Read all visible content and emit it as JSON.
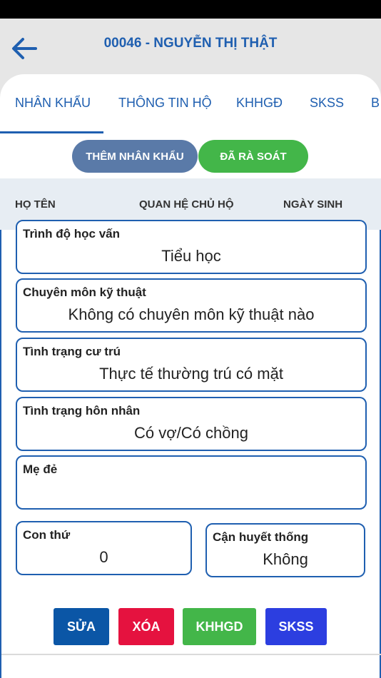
{
  "header": {
    "title": "00046 - NGUYỄN THỊ THẬT"
  },
  "tabs": [
    {
      "label": "NHÂN KHẨU"
    },
    {
      "label": "THÔNG TIN HỘ"
    },
    {
      "label": "KHHGĐ"
    },
    {
      "label": "SKSS"
    },
    {
      "label": "B"
    }
  ],
  "buttons": {
    "add_member": "THÊM NHÂN KHẨU",
    "reviewed": "ĐÃ RÀ SOÁT"
  },
  "columns": [
    "HỌ TÊN",
    "QUAN HỆ CHỦ HỘ",
    "NGÀY SINH"
  ],
  "fields": {
    "education": {
      "label": "Trình độ học vấn",
      "value": "Tiểu học"
    },
    "specialty": {
      "label": "Chuyên môn kỹ thuật",
      "value": "Không có chuyên môn kỹ thuật nào"
    },
    "residence": {
      "label": "Tình trạng cư trú",
      "value": "Thực tế thường trú có mặt"
    },
    "marital": {
      "label": "Tình trạng hôn nhân",
      "value": "Có vợ/Có chồng"
    },
    "mother": {
      "label": "Mẹ đẻ",
      "value": ""
    },
    "child_order": {
      "label": "Con thứ",
      "value": "0"
    },
    "consanguinity": {
      "label": "Cận huyết thống",
      "value": "Không"
    }
  },
  "actions": {
    "edit": "SỬA",
    "delete": "XÓA",
    "khhgd": "KHHGD",
    "skss": "SKSS"
  },
  "colors": {
    "primary": "#1f5fb0",
    "green": "#43b649",
    "red": "#e5123f",
    "blue_dark": "#0b56a6",
    "blue_bright": "#2c3ee0"
  }
}
